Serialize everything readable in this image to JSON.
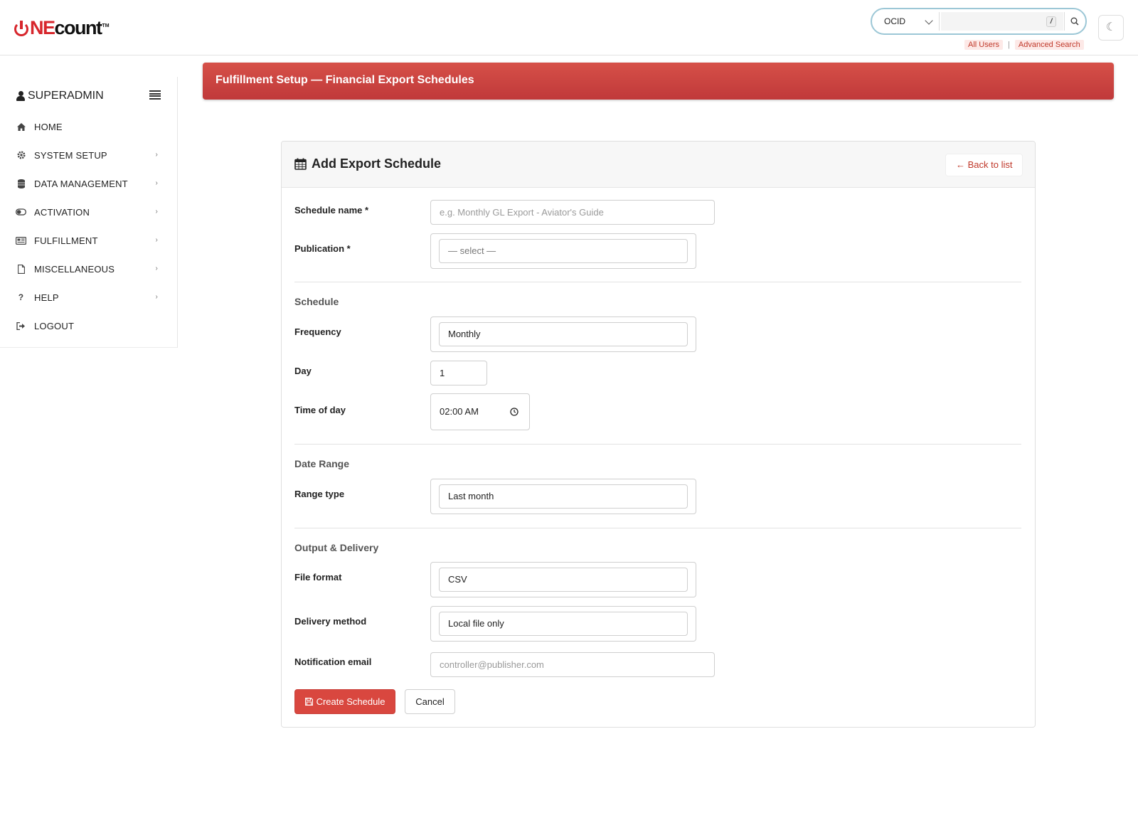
{
  "brand": {
    "logo_one": "NE",
    "logo_count": "count",
    "logo_tm": "TM",
    "accent": "#d7262c"
  },
  "search": {
    "scope_selected": "OCID",
    "input_value": "",
    "shortcut_key": "/",
    "all_users_link": "All Users",
    "separator": "|",
    "advanced_link": "Advanced Search"
  },
  "theme_toggle_glyph": "☾",
  "sidebar": {
    "user": "SUPERADMIN",
    "items": [
      {
        "label": "HOME",
        "icon": "home-icon",
        "has_children": false
      },
      {
        "label": "SYSTEM SETUP",
        "icon": "gear-icon",
        "has_children": true
      },
      {
        "label": "DATA MANAGEMENT",
        "icon": "database-icon",
        "has_children": true
      },
      {
        "label": "ACTIVATION",
        "icon": "toggle-icon",
        "has_children": true
      },
      {
        "label": "FULFILLMENT",
        "icon": "newspaper-icon",
        "has_children": true
      },
      {
        "label": "MISCELLANEOUS",
        "icon": "file-icon",
        "has_children": true
      },
      {
        "label": "HELP",
        "icon": "question-icon",
        "has_children": true
      },
      {
        "label": "LOGOUT",
        "icon": "logout-icon",
        "has_children": false
      }
    ],
    "arrow": "›"
  },
  "banner": {
    "title": "Fulfillment Setup — Financial Export Schedules"
  },
  "card": {
    "title": "Add Export Schedule",
    "back_link": "← Back to list"
  },
  "form": {
    "schedule_name": {
      "label": "Schedule name *",
      "placeholder": "e.g. Monthly GL Export - Aviator's Guide",
      "value": ""
    },
    "publication": {
      "label": "Publication *",
      "selected": "— select —"
    },
    "schedule_section": "Schedule",
    "frequency": {
      "label": "Frequency",
      "selected": "Monthly"
    },
    "day": {
      "label": "Day",
      "value": "1"
    },
    "time_of_day": {
      "label": "Time of day",
      "value": "02:00 AM"
    },
    "date_range_section": "Date Range",
    "range_type": {
      "label": "Range type",
      "selected": "Last month"
    },
    "output_section": "Output & Delivery",
    "file_format": {
      "label": "File format",
      "selected": "CSV"
    },
    "delivery_method": {
      "label": "Delivery method",
      "selected": "Local file only"
    },
    "notification_email": {
      "label": "Notification email",
      "placeholder": "controller@publisher.com",
      "value": ""
    },
    "create_button": "Create Schedule",
    "cancel_button": "Cancel"
  }
}
